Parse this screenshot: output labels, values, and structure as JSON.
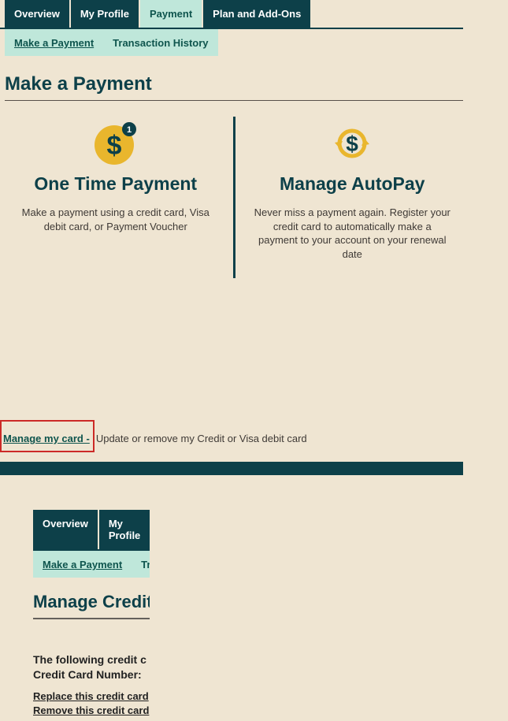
{
  "tabs": {
    "overview": "Overview",
    "profile": "My Profile",
    "payment": "Payment",
    "plan": "Plan and Add-Ons"
  },
  "subtabs": {
    "make_payment": "Make a Payment",
    "history": "Transaction History"
  },
  "page_title": "Make a Payment",
  "one_time": {
    "title": "One Time Payment",
    "desc": "Make a payment using a credit card, Visa debit card, or Payment Voucher",
    "badge": "1"
  },
  "autopay": {
    "title": "Manage AutoPay",
    "desc": "Never miss a payment again. Register your credit card to automatically make a payment to your account on your renewal date"
  },
  "manage_card": {
    "link": "Manage my card - ",
    "tail": "Update or remove my Credit or Visa debit card"
  },
  "bottom": {
    "tabs": {
      "overview": "Overview",
      "profile": "My Profile"
    },
    "subtabs": {
      "make_payment": "Make a Payment",
      "history_cut": "Trans"
    },
    "title_cut": "Manage Credit",
    "line1_cut": "The following credit c",
    "line2_cut": "Credit Card Number:",
    "replace": "Replace this credit card",
    "remove": "Remove this credit card"
  }
}
